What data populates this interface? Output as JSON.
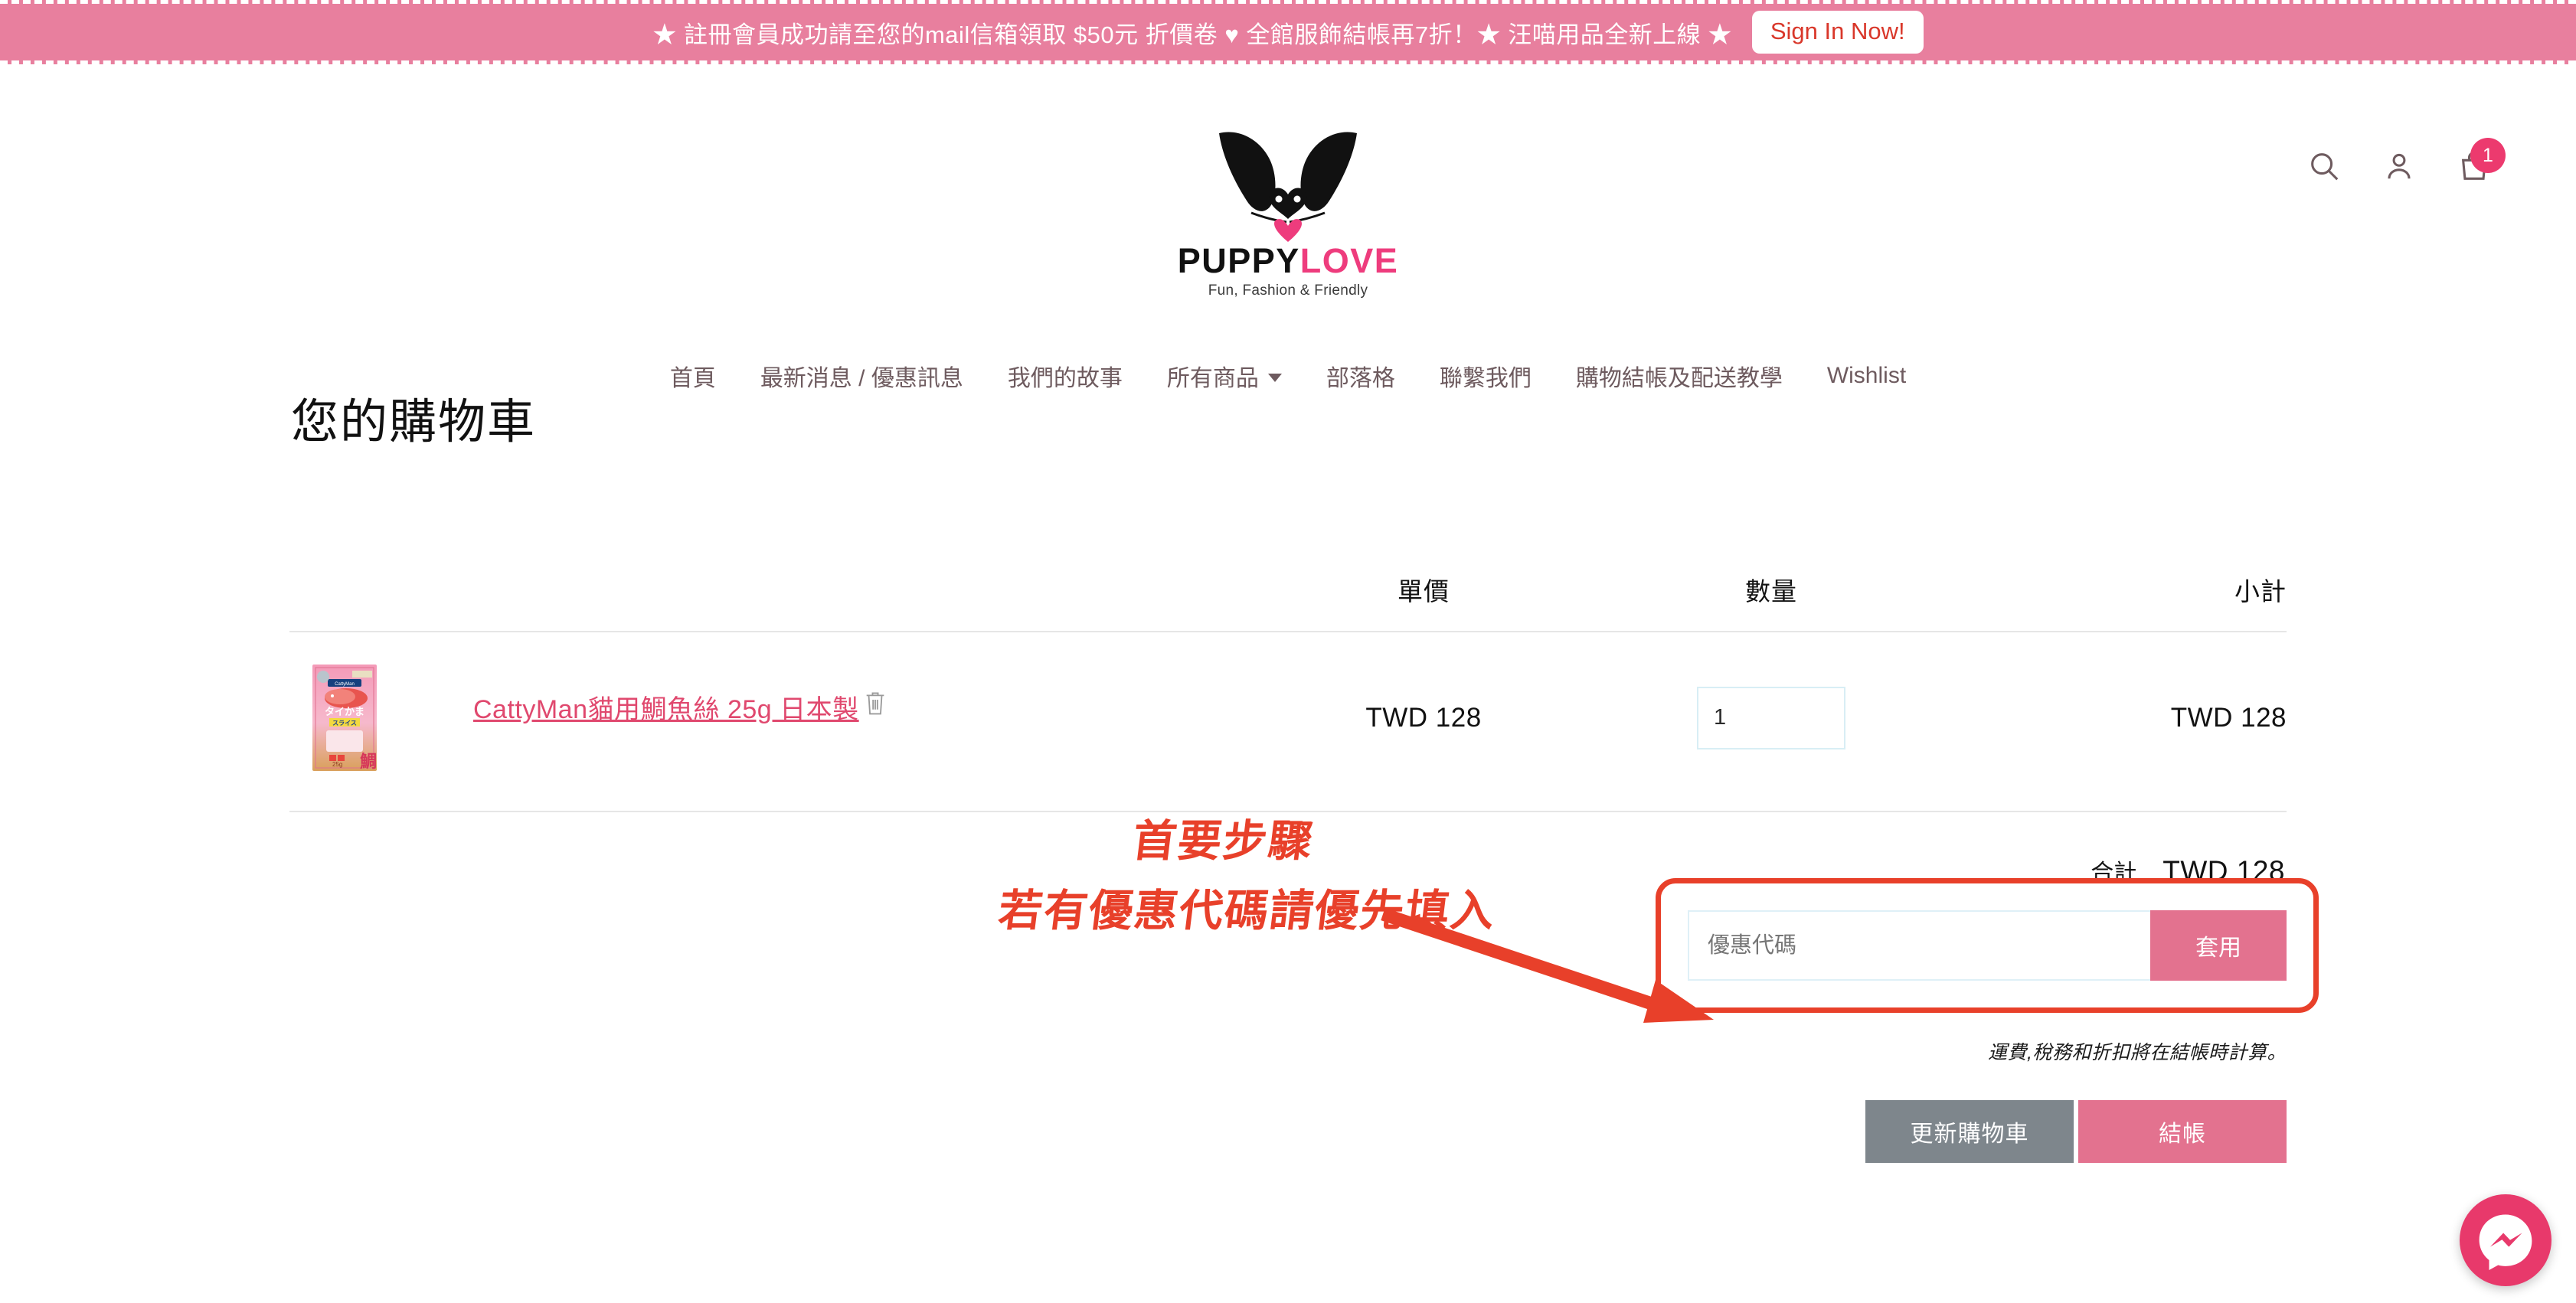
{
  "promo": {
    "text": "★ 註冊會員成功請至您的mail信箱領取 $50元 折價卷 ♥ 全館服飾結帳再7折！★ 汪喵用品全新上線 ★",
    "button_label": "Sign In Now!",
    "bg_color": "#e87f9e",
    "button_text_color": "#d9372a"
  },
  "header": {
    "logo": {
      "word_dark": "PUPPY",
      "word_pink": "LOVE",
      "tagline": "Fun, Fashion & Friendly",
      "pink": "#ee3c7d"
    },
    "icons": {
      "search": "search-icon",
      "account": "account-icon",
      "cart": "shopping-bag-icon",
      "cart_count": "1"
    }
  },
  "nav": {
    "items": [
      {
        "label": "首頁",
        "has_caret": false
      },
      {
        "label": "最新消息 / 優惠訊息",
        "has_caret": false
      },
      {
        "label": "我們的故事",
        "has_caret": false
      },
      {
        "label": "所有商品",
        "has_caret": true
      },
      {
        "label": "部落格",
        "has_caret": false
      },
      {
        "label": "聯繫我們",
        "has_caret": false
      },
      {
        "label": "購物結帳及配送教學",
        "has_caret": false
      },
      {
        "label": "Wishlist",
        "has_caret": false
      }
    ]
  },
  "cart": {
    "title": "您的購物車",
    "columns": {
      "product": "",
      "price": "單價",
      "quantity": "數量",
      "subtotal": "小計"
    },
    "items": [
      {
        "title": "CattyMan貓用鯛魚絲 25g 日本製",
        "price": "TWD 128",
        "quantity": "1",
        "subtotal": "TWD 128",
        "remove_label": "trash-icon"
      }
    ],
    "total_label": "合計",
    "total_value": "TWD 128",
    "discount_placeholder": "優惠代碼",
    "apply_label": "套用",
    "tax_note": "運費,稅務和折扣將在結帳時計算。",
    "update_label": "更新購物車",
    "checkout_label": "結帳"
  },
  "annotations": {
    "line1": "首要步驟",
    "line2": "若有優惠代碼請優先填入",
    "color": "#e8402a",
    "arrow": "arrow-pointing-to-discount-box"
  },
  "widgets": {
    "messenger": "messenger-icon"
  }
}
